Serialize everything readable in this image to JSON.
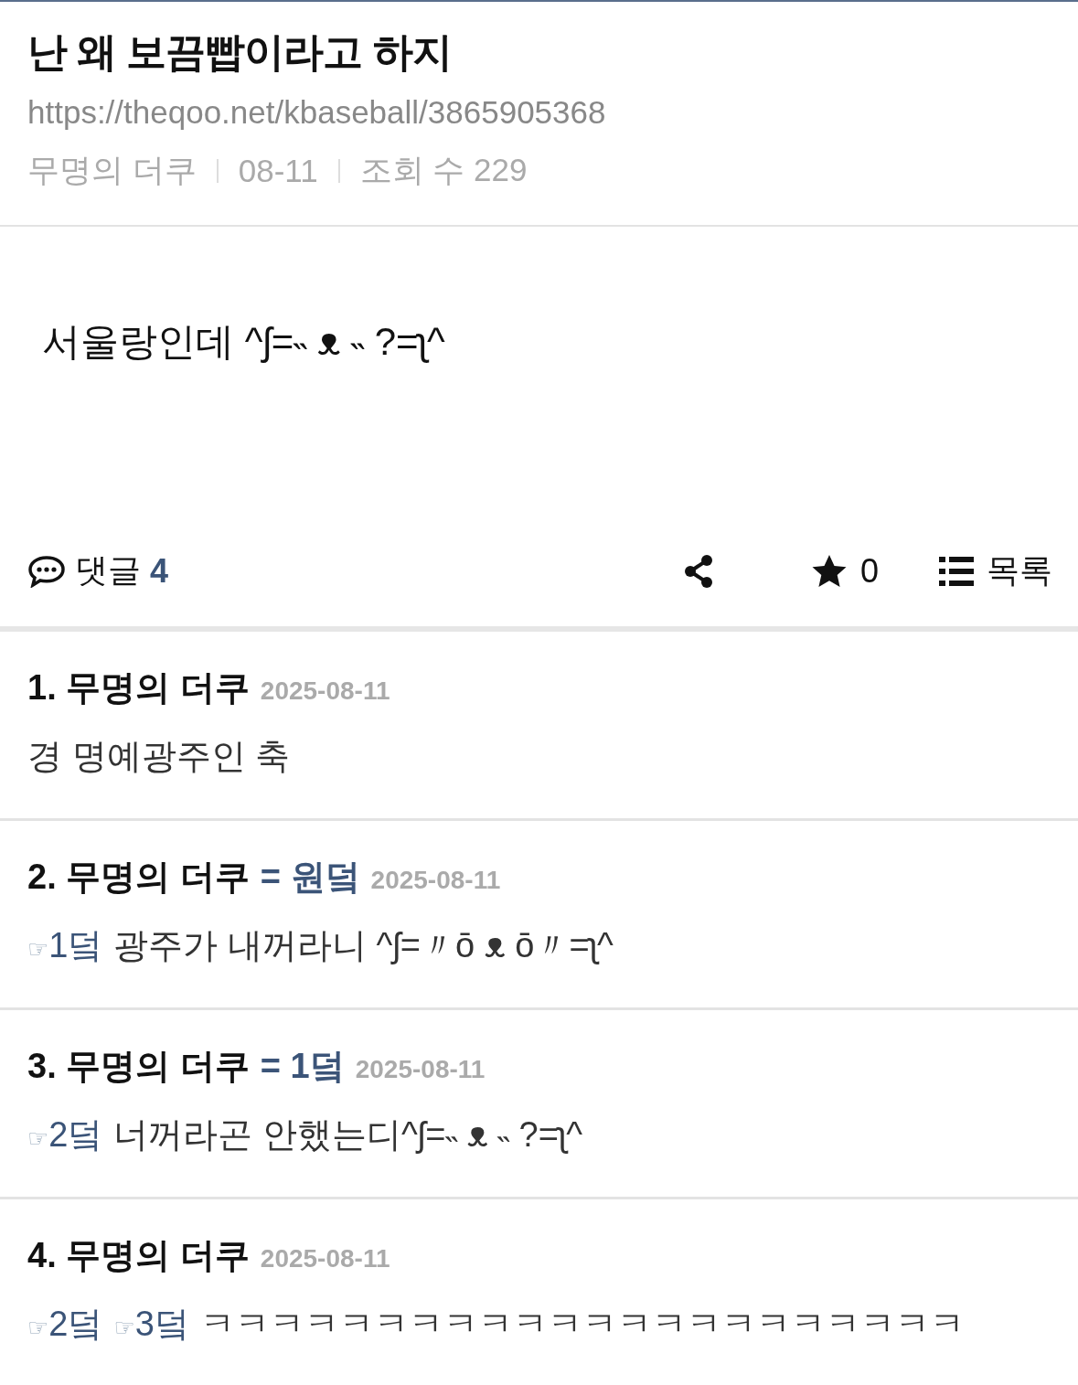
{
  "post": {
    "title": "난 왜 보끔빱이라고 하지",
    "url": "https://theqoo.net/kbaseball/3865905368",
    "author": "무명의 더쿠",
    "date": "08-11",
    "views": "조회 수 229"
  },
  "body": "서울랑인데 ^ʃ=˵ ᴥ ˵ ?=ʅ^",
  "actions": {
    "comments_label": "댓글",
    "comment_count": "4",
    "star_count": "0",
    "list_label": "목록"
  },
  "comments": [
    {
      "number": "1.",
      "author": "무명의 더쿠",
      "date": "2025-08-11",
      "text": "경 명예광주인 축"
    },
    {
      "number": "2.",
      "author": "무명의 더쿠",
      "tag": "= 원덬",
      "date": "2025-08-11",
      "replies": [
        {
          "hand": "☞",
          "label": "1덬"
        }
      ],
      "text": "광주가 내꺼라니 ^ʃ=〃ō ᴥ ō〃=ʅ^"
    },
    {
      "number": "3.",
      "author": "무명의 더쿠",
      "tag": "= 1덬",
      "date": "2025-08-11",
      "replies": [
        {
          "hand": "☞",
          "label": "2덬"
        }
      ],
      "text": "너꺼라곤 안했는디^ʃ=˵ ᴥ ˵ ?=ʅ^"
    },
    {
      "number": "4.",
      "author": "무명의 더쿠",
      "date": "2025-08-11",
      "replies": [
        {
          "hand": "☞",
          "label": "2덬"
        },
        {
          "hand": "☞",
          "label": "3덬"
        }
      ],
      "text": "ㅋㅋㅋㅋㅋㅋㅋㅋㅋㅋㅋㅋㅋㅋㅋㅋㅋㅋㅋㅋㅋㅋ"
    }
  ]
}
